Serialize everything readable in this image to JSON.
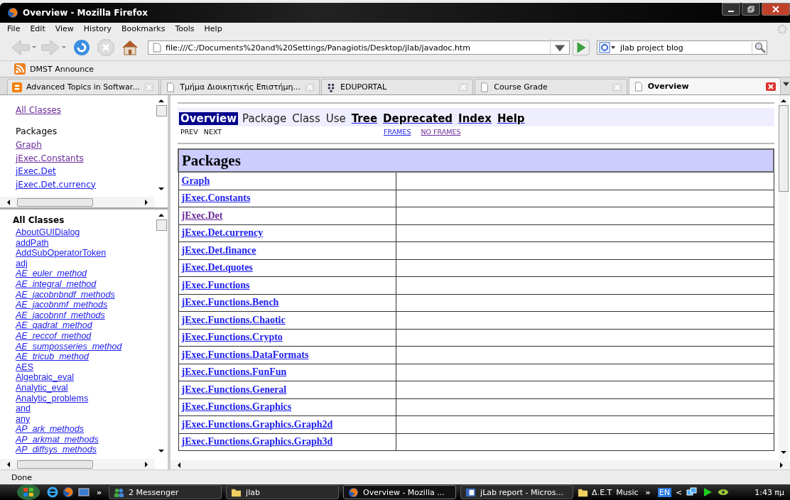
{
  "window": {
    "title": "Overview - Mozilla Firefox"
  },
  "menu": [
    "File",
    "Edit",
    "View",
    "History",
    "Bookmarks",
    "Tools",
    "Help"
  ],
  "address": {
    "value": "file:///C:/Documents%20and%20Settings/Panagiotis/Desktop/jlab/javadoc.htm"
  },
  "search": {
    "value": "jlab project blog"
  },
  "bookmarks": [
    "DMST Announce"
  ],
  "tabs": [
    {
      "label": "Advanced Topics in Softwar...",
      "kind": "blog",
      "selected": false
    },
    {
      "label": "Τμήμα Διοικητικής Επιστήμη...",
      "kind": "page",
      "selected": false
    },
    {
      "label": "EDUPORTAL",
      "kind": "dots",
      "selected": false
    },
    {
      "label": "Course Grade",
      "kind": "page",
      "selected": false
    },
    {
      "label": "Overview",
      "kind": "page",
      "selected": true
    }
  ],
  "packages_frame": {
    "all_classes_link": "All Classes",
    "heading": "Packages",
    "items": [
      {
        "label": "Graph",
        "visited": true
      },
      {
        "label": "jExec.Constants",
        "visited": true
      },
      {
        "label": "jExec.Det",
        "visited": false
      },
      {
        "label": "jExec.Det.currency",
        "visited": false
      }
    ]
  },
  "classes_frame": {
    "heading": "All Classes",
    "items": [
      {
        "label": "AboutGUIDialog",
        "italic": false
      },
      {
        "label": "addPath",
        "italic": false
      },
      {
        "label": "AddSubOperatorToken",
        "italic": false
      },
      {
        "label": "adj",
        "italic": false
      },
      {
        "label": "AE_euler_method",
        "italic": true
      },
      {
        "label": "AE_integral_method",
        "italic": true
      },
      {
        "label": "AE_jacobnbndf_methods",
        "italic": true
      },
      {
        "label": "AE_jacobnmf_methods",
        "italic": true
      },
      {
        "label": "AE_jacobnnf_methods",
        "italic": true
      },
      {
        "label": "AE_qadrat_method",
        "italic": true
      },
      {
        "label": "AE_reccof_method",
        "italic": true
      },
      {
        "label": "AE_sumposseries_method",
        "italic": true
      },
      {
        "label": "AE_tricub_method",
        "italic": true
      },
      {
        "label": "AES",
        "italic": false
      },
      {
        "label": "Algebraic_eval",
        "italic": false
      },
      {
        "label": "Analytic_eval",
        "italic": false
      },
      {
        "label": "Analytic_problems",
        "italic": false
      },
      {
        "label": "and",
        "italic": false
      },
      {
        "label": "any",
        "italic": false
      },
      {
        "label": "AP_ark_methods",
        "italic": true
      },
      {
        "label": "AP_arkmat_methods",
        "italic": true
      },
      {
        "label": "AP_diffsys_methods",
        "italic": true
      }
    ]
  },
  "navbar": {
    "items": [
      {
        "label": "Overview",
        "kind": "current"
      },
      {
        "label": "Package",
        "kind": "plain"
      },
      {
        "label": "Class",
        "kind": "plain"
      },
      {
        "label": "Use",
        "kind": "plain"
      },
      {
        "label": "Tree",
        "kind": "link"
      },
      {
        "label": "Deprecated",
        "kind": "link"
      },
      {
        "label": "Index",
        "kind": "link"
      },
      {
        "label": "Help",
        "kind": "link"
      }
    ],
    "sub_left": [
      "PREV",
      "NEXT"
    ],
    "sub_right": [
      {
        "label": "FRAMES",
        "visited": false
      },
      {
        "label": "NO FRAMES",
        "visited": true
      }
    ]
  },
  "packages_table": {
    "heading": "Packages",
    "rows": [
      {
        "name": "Graph",
        "visited": false
      },
      {
        "name": "jExec.Constants",
        "visited": false
      },
      {
        "name": "jExec.Det",
        "visited": true
      },
      {
        "name": "jExec.Det.currency",
        "visited": false
      },
      {
        "name": "jExec.Det.finance",
        "visited": false
      },
      {
        "name": "jExec.Det.quotes",
        "visited": false
      },
      {
        "name": "jExec.Functions",
        "visited": false
      },
      {
        "name": "jExec.Functions.Bench",
        "visited": false
      },
      {
        "name": "jExec.Functions.Chaotic",
        "visited": false
      },
      {
        "name": "jExec.Functions.Crypto",
        "visited": false
      },
      {
        "name": "jExec.Functions.DataFormats",
        "visited": false
      },
      {
        "name": "jExec.Functions.FunFun",
        "visited": false
      },
      {
        "name": "jExec.Functions.General",
        "visited": false
      },
      {
        "name": "jExec.Functions.Graphics",
        "visited": false
      },
      {
        "name": "jExec.Functions.Graphics.Graph2d",
        "visited": false
      },
      {
        "name": "jExec.Functions.Graphics.Graph3d",
        "visited": false
      }
    ]
  },
  "status_bar": {
    "text": "Done"
  },
  "taskbar": {
    "more": "»",
    "tasks": [
      {
        "label": "2 Messenger",
        "kind": "people",
        "selected": false
      },
      {
        "label": "jlab",
        "kind": "folder",
        "selected": false
      },
      {
        "label": "Overview - Mozilla ...",
        "kind": "firefox",
        "selected": true
      },
      {
        "label": "jLab report - Micros...",
        "kind": "word",
        "selected": false
      }
    ],
    "toolbars": [
      {
        "label": "Δ.E.T",
        "kind": "folder"
      },
      {
        "label": "Music",
        "kind": "text"
      }
    ],
    "toolbar_more": "»",
    "language": "EN",
    "tray_toggle": "<",
    "clock": "1:43 πμ"
  }
}
